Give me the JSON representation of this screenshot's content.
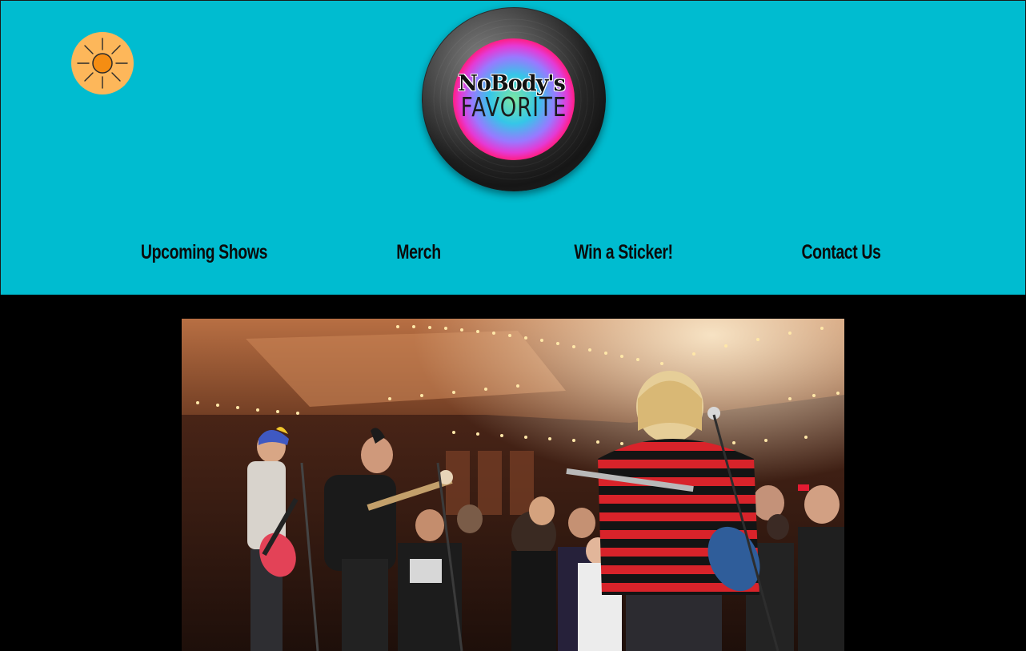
{
  "header": {
    "background_color": "#00bcd0",
    "theme_toggle": {
      "icon": "sun-icon",
      "color": "#fdb75a"
    },
    "logo": {
      "line1": "NoBody's",
      "line2": "FAVORITE"
    }
  },
  "nav": {
    "items": [
      {
        "label": "Upcoming Shows"
      },
      {
        "label": "Merch"
      },
      {
        "label": "Win a Sticker!"
      },
      {
        "label": "Contact Us"
      }
    ]
  },
  "hero": {
    "image": "band-performing-photo",
    "alt": "Band performing live on stage in a ballroom with crowd"
  },
  "colors": {
    "page_background": "#000000",
    "accent": "#00bcd0",
    "sun": "#fdb75a"
  }
}
